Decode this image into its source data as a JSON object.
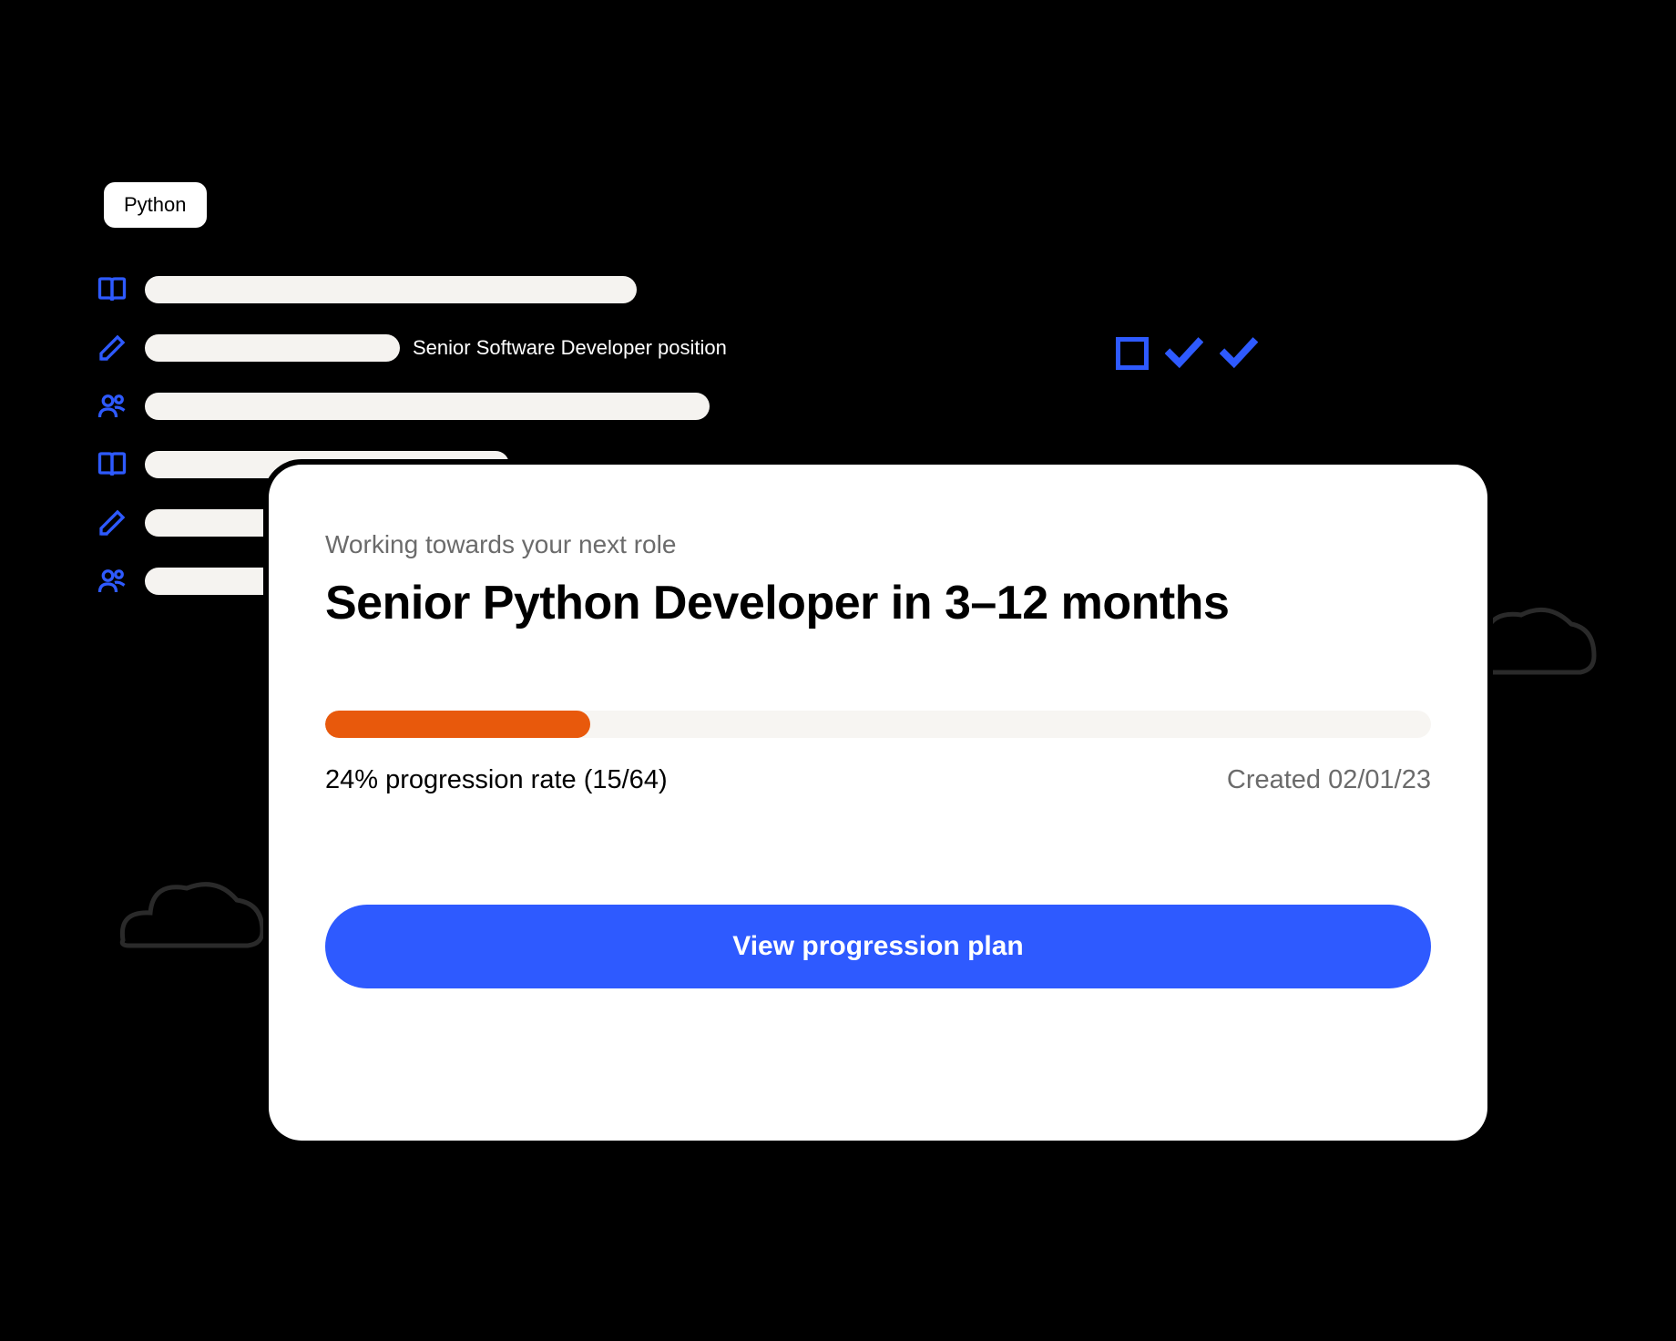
{
  "tag": {
    "label": "Python"
  },
  "tasks": {
    "row2_text": "Senior Software Developer position",
    "bars": {
      "w1": 540,
      "w2": 280,
      "w3": 620,
      "w4": 400,
      "w5": 420,
      "w6": 490
    }
  },
  "card": {
    "subtitle": "Working towards your next role",
    "title": "Senior Python Developer in 3–12 months",
    "progress_percent": 24,
    "progress_text": "24% progression rate (15/64)",
    "created_text": "Created 02/01/23",
    "button_label": "View progression plan"
  },
  "colors": {
    "accent_blue": "#2E5AFF",
    "accent_orange": "#E8590C"
  }
}
